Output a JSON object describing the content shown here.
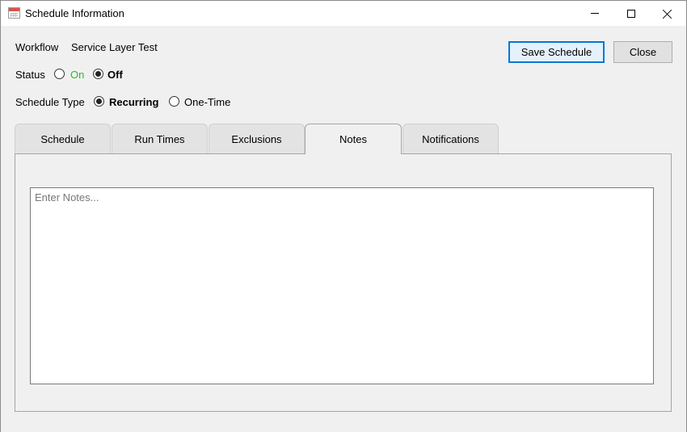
{
  "window": {
    "title": "Schedule Information",
    "icon": "calendar-icon"
  },
  "form": {
    "workflow_label": "Workflow",
    "workflow_value": "Service Layer Test",
    "status_label": "Status",
    "status_on_label": "On",
    "status_off_label": "Off",
    "status_selected": "Off",
    "schedule_type_label": "Schedule Type",
    "schedule_type_recurring_label": "Recurring",
    "schedule_type_onetime_label": "One-Time",
    "schedule_type_selected": "Recurring"
  },
  "buttons": {
    "save_label": "Save Schedule",
    "close_label": "Close"
  },
  "tabs": [
    {
      "label": "Schedule"
    },
    {
      "label": "Run Times"
    },
    {
      "label": "Exclusions"
    },
    {
      "label": "Notes"
    },
    {
      "label": "Notifications"
    }
  ],
  "active_tab": "Notes",
  "notes": {
    "value": "",
    "placeholder": "Enter Notes..."
  },
  "colors": {
    "on_label": "#2eb82e",
    "primary_button_border": "#0078d7"
  }
}
